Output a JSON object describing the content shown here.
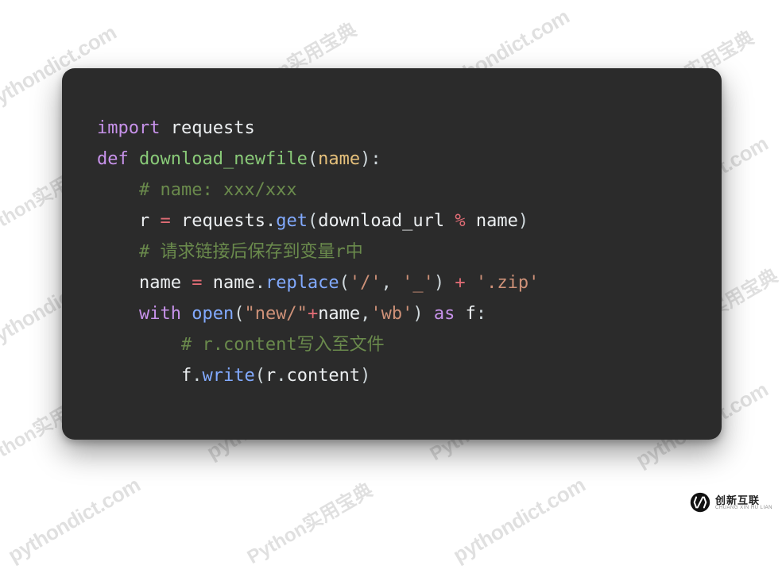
{
  "watermark": {
    "text": "pythondict.com",
    "cn": "Python实用宝典"
  },
  "code": {
    "l1": {
      "import": "import",
      "module": "requests"
    },
    "l2": {
      "def": "def",
      "fname": "download_newfile",
      "param": "name"
    },
    "l3": {
      "comment": "# name: xxx/xxx"
    },
    "l4": {
      "r": "r",
      "eq": "=",
      "lib": "requests",
      "get": "get",
      "arg1": "download_url",
      "pct": "%",
      "arg2": "name"
    },
    "l5": {
      "comment": "# 请求链接后保存到变量r中"
    },
    "l6": {
      "name": "name",
      "eq": "=",
      "obj": "name",
      "method": "replace",
      "s1": "'/'",
      "s2": "'_'",
      "plus": "+",
      "s3": "'.zip'"
    },
    "l7": {
      "with": "with",
      "open": "open",
      "s1": "\"new/\"",
      "plus": "+",
      "arg": "name",
      "s2": "'wb'",
      "as": "as",
      "f": "f"
    },
    "l8": {
      "comment": "# r.content写入至文件"
    },
    "l9": {
      "f": "f",
      "write": "write",
      "r": "r",
      "content": "content"
    }
  },
  "footer": {
    "cn": "创新互联",
    "en": "CHUANG XIN HU LIAN"
  }
}
